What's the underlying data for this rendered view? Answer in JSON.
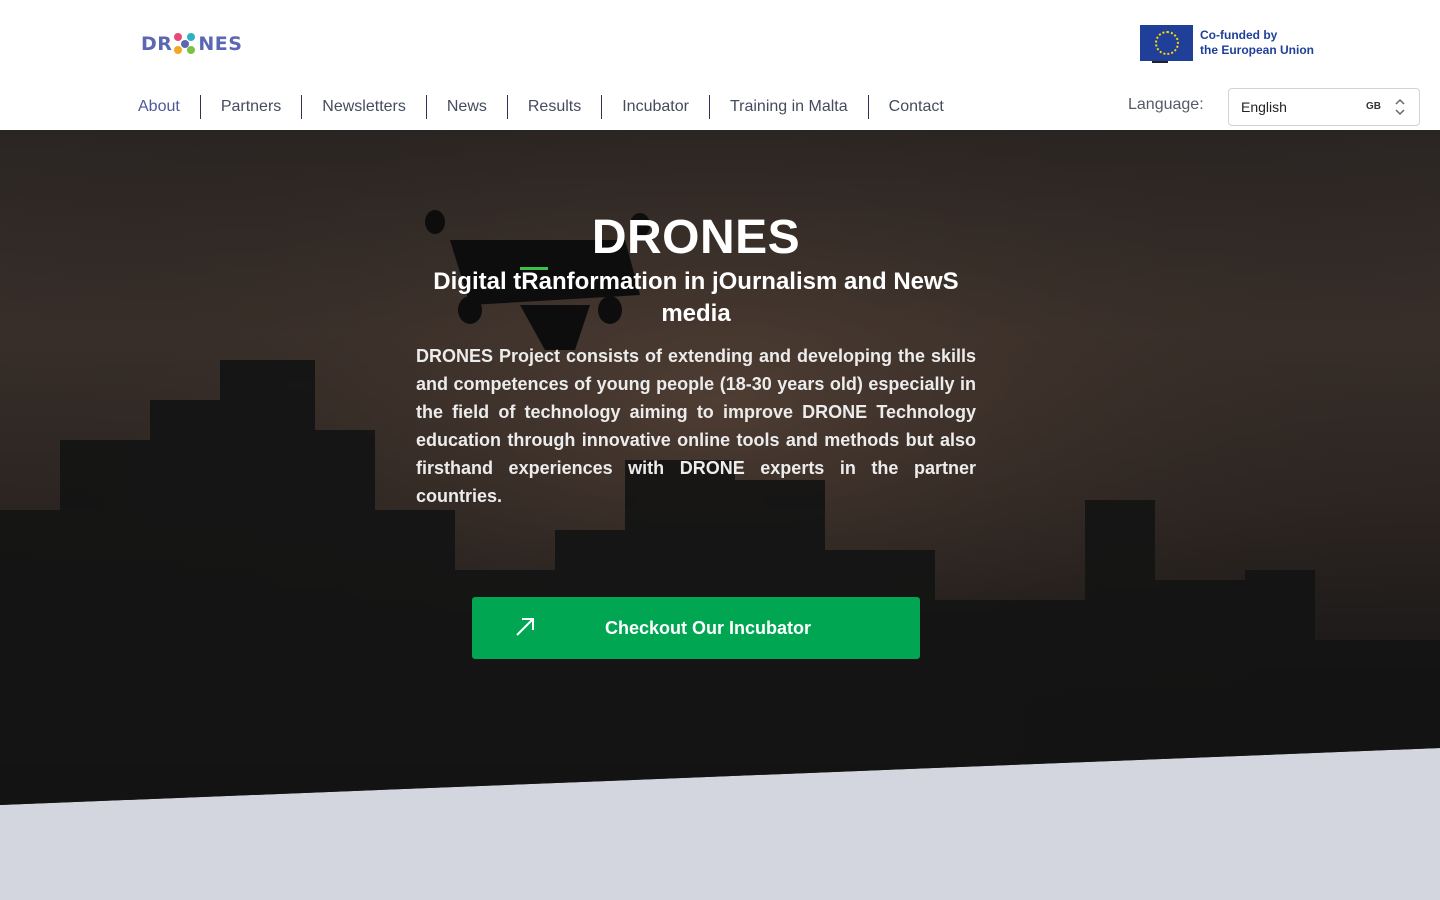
{
  "brand": {
    "logo_left": "DR",
    "logo_right": "NES",
    "eu_line1": "Co-funded by",
    "eu_line2": "the European Union"
  },
  "nav": {
    "items": [
      "About",
      "Partners",
      "Newsletters",
      "News",
      "Results",
      "Incubator",
      "Training in Malta",
      "Contact"
    ]
  },
  "language": {
    "label": "Language:",
    "selected": "English",
    "flag": "GB"
  },
  "hero": {
    "title": "DRONES",
    "subtitle": "Digital tRanformation in jOurnalism and NewS media",
    "description": "DRONES Project consists of extending and developing the skills and competences of young people (18-30 years old) especially in the field of technology aiming to improve DRONE Technology education through innovative online tools and methods but also firsthand experiences with DRONE experts in the partner countries.",
    "cta_label": "Checkout Our Incubator"
  },
  "icons": {
    "cta": "arrow-up-right-icon",
    "select": "chevron-up-down-icon"
  },
  "colors": {
    "brand": "#5b67b3",
    "nav_text": "#4d5a99",
    "eu_blue": "#1f3f99",
    "cta_green": "#00a651",
    "section_gray": "#d3d6de"
  }
}
